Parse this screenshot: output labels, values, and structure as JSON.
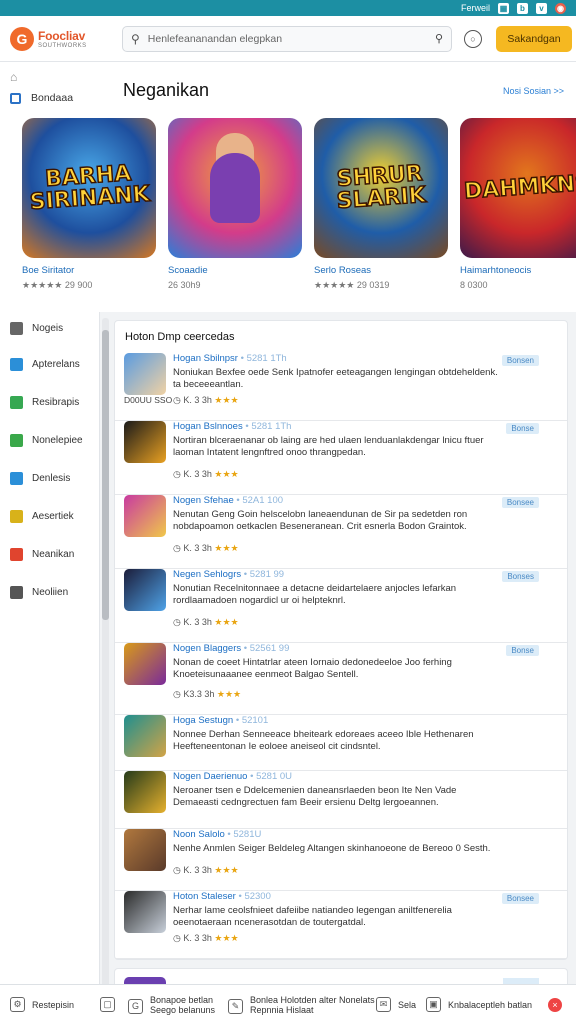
{
  "system_bar": {
    "label": "Ferweil",
    "icons": [
      "grid",
      "b",
      "v",
      "o"
    ]
  },
  "header": {
    "logo_name": "Foocliav",
    "logo_sub": "SOUTHWORKS",
    "search_placeholder": "Henlefeananandan elegpkan",
    "cta_label": "Sakandgan"
  },
  "side_top": {
    "category_label": "Bondaaa"
  },
  "featured": {
    "title": "Neganikan",
    "more_label": "Nosi Sosian",
    "tiles": [
      {
        "art": "BARHA\nSIRINANK",
        "name": "Boe Siritator",
        "rating": "★★★★★ 29 900",
        "colors": [
          "#1e4f9e",
          "#49a8e8",
          "#d77820"
        ]
      },
      {
        "art": "",
        "name": "Scoaadie",
        "rating": "26 30h9",
        "colors": [
          "#d33c8a",
          "#f0a23a",
          "#2a7fd8"
        ]
      },
      {
        "art": "SHRUR\nSLARIK",
        "name": "Serlo Roseas",
        "rating": "★★★★★ 29 0319",
        "colors": [
          "#1f5da8",
          "#f2d02f",
          "#7a4a22"
        ]
      },
      {
        "art": "DAHMKNS",
        "name": "Haimarhtoneocis",
        "rating": "8 0300",
        "colors": [
          "#c9272a",
          "#e2761d",
          "#3b1a4a"
        ]
      }
    ]
  },
  "nav": [
    {
      "label": "Nogeis",
      "color": "#666666"
    },
    {
      "label": "Apterelans",
      "color": "#2b8fd8"
    },
    {
      "label": "Resibrapis",
      "color": "#36a852"
    },
    {
      "label": "Nonelepiee",
      "color": "#3aa84a"
    },
    {
      "label": "Denlesis",
      "color": "#2b8fd8"
    },
    {
      "label": "Aesertiek",
      "color": "#d8b21a"
    },
    {
      "label": "Neanikan",
      "color": "#e0442e"
    },
    {
      "label": "Neoliien",
      "color": "#555555"
    }
  ],
  "list": {
    "title": "Hoton Dmp ceercedas",
    "rows": [
      {
        "title": "Hogan Sbilnpsr",
        "sub": "• 5281 1Th",
        "desc": "Noniukan Bexfee oede Senk Ipatnofer eeteagangen lengingan obtdeheldenk. ta beceeeantlan.",
        "meta": "K. 3 3h",
        "tag": "Bonsen",
        "dl": "D00UU SSO",
        "c1": "#5a9be0",
        "c2": "#f1d2a4"
      },
      {
        "title": "Hogan Bslnnoes",
        "sub": "• 5281 1Th",
        "desc": "Nortiran blceraenanar ob laing are hed ulaen lenduanlakdengar lnicu ftuer laoman Intatent lengnftred onoo thrangpedan.",
        "meta": "K. 3 3h",
        "tag": "Bonse",
        "dl": "",
        "c1": "#1a1a1a",
        "c2": "#e9a122"
      },
      {
        "title": "Nogen Sfehae",
        "sub": "• 52A1 100",
        "desc": "Nenutan Geng Goin helscelobn laneaendunan de Sir pa sedetden ron nobdapoamon oetkaclen Beseneranean. Crit esnerla Bodon Graintok.",
        "meta": "K. 3 3h",
        "tag": "Bonsee",
        "dl": "",
        "c1": "#c83aa0",
        "c2": "#f0c84a"
      },
      {
        "title": "Negen Sehlogrs",
        "sub": "• 5281 99",
        "desc": "Nonutian Recelnitonnaee a detacne deidartelaere anjocles lefarkan rordlaamadoen nogardicl ur oi helpteknrl.",
        "meta": "K. 3 3h",
        "tag": "Bonses",
        "dl": "",
        "c1": "#1b1d3a",
        "c2": "#4fa3e8"
      },
      {
        "title": "Nogen Blaggers",
        "sub": "• 52561 99",
        "desc": "Nonan de coeet Hintatrlar ateen Iornaio dedonedeeloe Joo ferhing Knoeteisunaaanee eenmeot Balgao Sentell.",
        "meta": "K3.3 3h",
        "tag": "Bonse",
        "dl": "",
        "c1": "#d89a1a",
        "c2": "#7a2a9a"
      },
      {
        "title": "Hoga Sestugn",
        "sub": "• 52101",
        "desc": "Nonnee Derhan Senneeace bheiteark edoreaes aceeo Ible Hethenaren Heefteneentonan Ie eoloee aneiseol cit cindsntel.",
        "meta": "",
        "tag": "",
        "dl": "",
        "c1": "#1f8f8f",
        "c2": "#d3a446"
      },
      {
        "title": "Nogen Daerienuo",
        "sub": "• 5281 0U",
        "desc": "Neroaner tsen e Ddelcemenien daneansrlaeden beon Ite Nen Vade Demaeasti cedngrectuen fam Beeir ersienu Deltg lergoeannen.",
        "meta": "",
        "tag": "",
        "dl": "",
        "c1": "#243a1a",
        "c2": "#e6b12e"
      },
      {
        "title": "Noon Salolo",
        "sub": "• 5281U",
        "desc": "Nenhe Anmlen Seiger Beldeleg Altangen skinhanoeone de Bereoo 0 Sesth.",
        "meta": "K. 3 3h",
        "tag": "",
        "dl": "",
        "c1": "#b0783e",
        "c2": "#5a3a2a"
      },
      {
        "title": "Hoton Staleser",
        "sub": "• 52300",
        "desc": "Nerhar lame ceolsfnieet dafeiibe natiandeo legengan aniltfenerelia oeenotaeraan ncenerasotdan de toutergatdal.",
        "meta": "K. 3 3h",
        "tag": "Bonsee",
        "dl": "",
        "c1": "#2a2a2a",
        "c2": "#c8d0da"
      }
    ]
  },
  "bottom": [
    {
      "label": "Restepisin",
      "icon": "⚙"
    },
    {
      "label": "",
      "icon": "▢"
    },
    {
      "label": "Bonapoe betlan|Seego belanuns",
      "icon": "G"
    },
    {
      "label": "Bonlea Holotden alter Nonelats|Repnnia Hislaat",
      "icon": "✎"
    },
    {
      "label": "Sela",
      "icon": "✉"
    },
    {
      "label": "Knbalaceptleh batlan",
      "icon": "▣"
    }
  ]
}
